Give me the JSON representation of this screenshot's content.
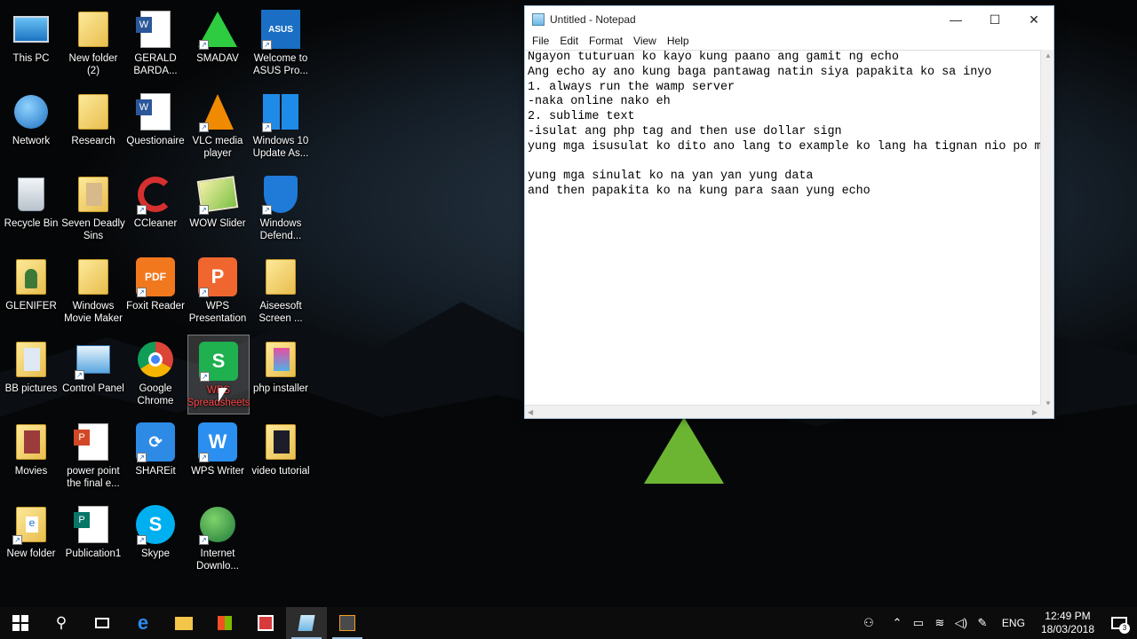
{
  "desktop": {
    "icons": [
      {
        "label": "This PC"
      },
      {
        "label": "New folder (2)"
      },
      {
        "label": "GERALD BARDA..."
      },
      {
        "label": "SMADAV"
      },
      {
        "label": "Welcome to ASUS Pro..."
      },
      {
        "label": "Network"
      },
      {
        "label": "Research"
      },
      {
        "label": "Questionaire"
      },
      {
        "label": "VLC media player"
      },
      {
        "label": "Windows 10 Update As..."
      },
      {
        "label": "Recycle Bin"
      },
      {
        "label": "Seven Deadly Sins"
      },
      {
        "label": "CCleaner"
      },
      {
        "label": "WOW Slider"
      },
      {
        "label": "Windows Defend..."
      },
      {
        "label": "GLENIFER"
      },
      {
        "label": "Windows Movie Maker"
      },
      {
        "label": "Foxit Reader"
      },
      {
        "label": "WPS Presentation"
      },
      {
        "label": "Aiseesoft Screen ..."
      },
      {
        "label": "BB pictures"
      },
      {
        "label": "Control Panel"
      },
      {
        "label": "Google Chrome"
      },
      {
        "label": "WPS Spreadsheets"
      },
      {
        "label": "php installer"
      },
      {
        "label": "Movies"
      },
      {
        "label": "power point the final e..."
      },
      {
        "label": "SHAREit"
      },
      {
        "label": "WPS Writer"
      },
      {
        "label": "video tutorial"
      },
      {
        "label": "New folder"
      },
      {
        "label": "Publication1"
      },
      {
        "label": "Skype"
      },
      {
        "label": "Internet Downlo..."
      }
    ]
  },
  "notepad": {
    "title": "Untitled - Notepad",
    "menu": [
      "File",
      "Edit",
      "Format",
      "View",
      "Help"
    ],
    "controls": {
      "minimize": "—",
      "maximize": "☐",
      "close": "✕"
    },
    "content": "Ngayon tuturuan ko kayo kung paano ang gamit ng echo\nAng echo ay ano kung baga pantawag natin siya papakita ko sa inyo\n1. always run the wamp server\n-naka online nako eh\n2. sublime text\n-isulat ang php tag and then use dollar sign\nyung mga isusulat ko dito ano lang to example ko lang ha tignan nio po maigi\n\nyung mga sinulat ko na yan yan yung data\nand then papakita ko na kung para saan yung echo"
  },
  "taskbar": {
    "clock_time": "12:49 PM",
    "clock_date": "18/03/2018",
    "language": "ENG",
    "notification_count": "3"
  },
  "colors": {
    "accent": "#0078d7",
    "taskbar": "#0c0c0c"
  }
}
